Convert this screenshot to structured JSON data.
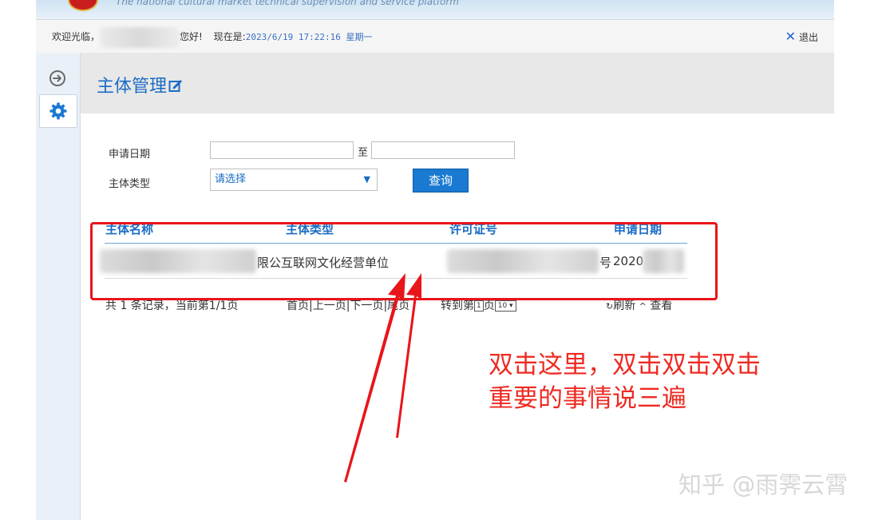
{
  "banner": {
    "subtitle": "The national cultural market technical supervision and service platform"
  },
  "userbar": {
    "greeting_prefix": "欢迎光临，",
    "greeting_suffix": "您好!",
    "now_label": "现在是:",
    "datetime": "2023/6/19 17:22:16 星期一",
    "logout_label": "退出"
  },
  "sidebar": {
    "items": [
      {
        "icon": "arrow-right-circle-icon"
      },
      {
        "icon": "gear-icon"
      }
    ]
  },
  "page": {
    "title": "主体管理"
  },
  "form": {
    "apply_date_label": "申请日期",
    "to_label": "至",
    "start_date_value": "",
    "end_date_value": "",
    "type_label": "主体类型",
    "type_selected": "请选择",
    "query_button": "查询"
  },
  "table": {
    "headers": [
      "主体名称",
      "主体类型",
      "许可证号",
      "申请日期"
    ],
    "rows": [
      {
        "name_visible": "限公",
        "type": "互联网文化经营单位",
        "license_visible": "号",
        "date_visible": "2020"
      }
    ]
  },
  "pager": {
    "summary": "共 1 条记录，当前第1/1页",
    "first": "首页",
    "prev": "上一页",
    "next": "下一页",
    "last": "尾页",
    "goto_prefix": "转到第",
    "goto_page": "1",
    "goto_suffix": "页",
    "page_size": "10",
    "refresh": "刷新",
    "view": "查看"
  },
  "annotation": {
    "line1": "双击这里，双击双击双击",
    "line2": "重要的事情说三遍"
  },
  "watermark": {
    "text": "知乎 @雨霁云霄"
  },
  "colors": {
    "accent": "#1a6cc4",
    "annotation_red": "#e8151a"
  }
}
